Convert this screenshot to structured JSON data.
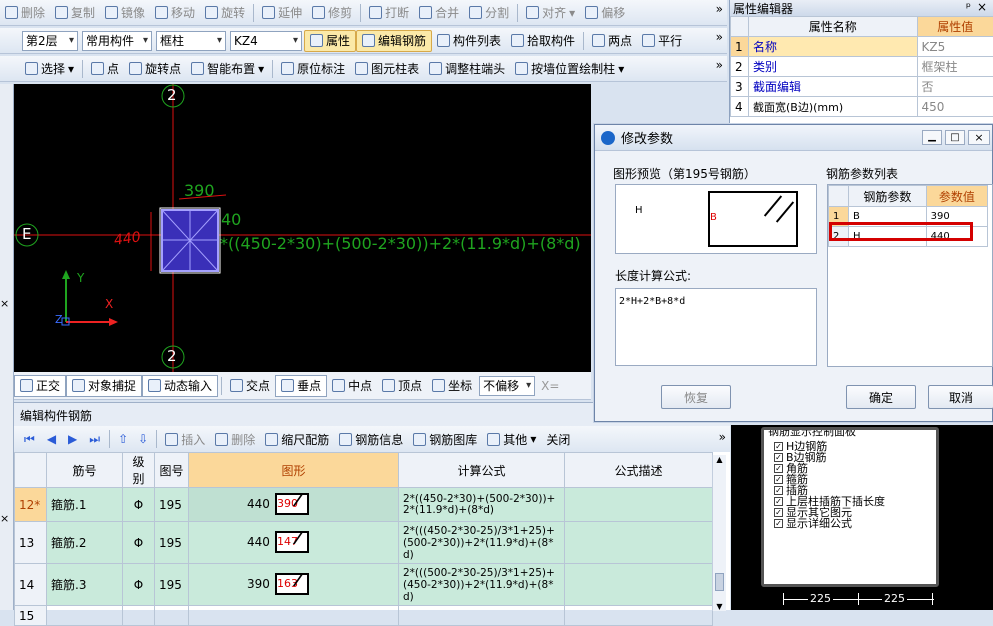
{
  "toolbar1": {
    "delete": "删除",
    "copy": "复制",
    "mirror": "镜像",
    "move": "移动",
    "rotate": "旋转",
    "extend": "延伸",
    "trim": "修剪",
    "break": "打断",
    "merge": "合并",
    "split": "分割",
    "align": "对齐",
    "offset": "偏移",
    "more": "»"
  },
  "toolbar2": {
    "floor": "第2层",
    "component_type": "常用构件",
    "element": "框柱",
    "name": "KZ4",
    "properties": "属性",
    "edit_rebar": "编辑钢筋",
    "component_list": "构件列表",
    "pick_component": "拾取构件",
    "two_points": "两点",
    "parallel": "平行",
    "more": "»"
  },
  "toolbar3": {
    "select": "选择",
    "point": "点",
    "rotate_point": "旋转点",
    "smart_layout": "智能布置",
    "in_situ_label": "原位标注",
    "element_table": "图元柱表",
    "adjust_column_end": "调整柱端头",
    "draw_by_wall": "按墙位置绘制柱",
    "more": "»"
  },
  "property_panel": {
    "title": "属性编辑器",
    "pin": "ᵖ",
    "close": "×",
    "col_name": "属性名称",
    "col_value": "属性值",
    "rows": [
      {
        "no": "1",
        "name": "名称",
        "value": "KZ5"
      },
      {
        "no": "2",
        "name": "类别",
        "value": "框架柱"
      },
      {
        "no": "3",
        "name": "截面编辑",
        "value": "否"
      },
      {
        "no": "4",
        "name": "截面宽(B边)(mm)",
        "value": "450"
      }
    ]
  },
  "canvas": {
    "axis_top": "2",
    "axis_bottom": "2",
    "axis_left": "E",
    "dim_top": "390",
    "dim_side": "40",
    "dim_left": "440",
    "formula": "*((450-2*30)+(500-2*30))+2*(11.9*d)+(8*d)",
    "ucs_y": "Y",
    "ucs_x": "X",
    "ucs_z": "Z"
  },
  "snap_bar": {
    "ortho": "正交",
    "object_snap": "对象捕捉",
    "dynamic_input": "动态输入",
    "intersection": "交点",
    "perpendicular": "垂点",
    "midpoint": "中点",
    "vertex": "顶点",
    "coordinate": "坐标",
    "no_offset": "不偏移",
    "x_label": "X="
  },
  "rebar_editor": {
    "title": "编辑构件钢筋",
    "toolbar": {
      "insert": "插入",
      "delete": "删除",
      "scale_rebar": "缩尺配筋",
      "rebar_info": "钢筋信息",
      "rebar_library": "钢筋图库",
      "other": "其他",
      "close": "关闭",
      "more": "»"
    },
    "headers": {
      "bar_no": "筋号",
      "grade": "级别",
      "shape_no": "图号",
      "shape": "图形",
      "formula": "计算公式",
      "description": "公式描述"
    },
    "rows": [
      {
        "idx": "12*",
        "bar_no": "箍筋.1",
        "grade": "Φ",
        "shape_no": "195",
        "left_val": "440",
        "inner_val": "390",
        "formula": "2*((450-2*30)+(500-2*30))+\n2*(11.9*d)+(8*d)",
        "description": ""
      },
      {
        "idx": "13",
        "bar_no": "箍筋.2",
        "grade": "Φ",
        "shape_no": "195",
        "left_val": "440",
        "inner_val": "147",
        "formula": "2*(((450-2*30-25)/3*1+25)+\n(500-2*30))+2*(11.9*d)+(8*\nd)",
        "description": ""
      },
      {
        "idx": "14",
        "bar_no": "箍筋.3",
        "grade": "Φ",
        "shape_no": "195",
        "left_val": "390",
        "inner_val": "163",
        "formula": "2*(((500-2*30-25)/3*1+25)+\n(450-2*30))+2*(11.9*d)+(8*\nd)",
        "description": ""
      },
      {
        "idx": "15",
        "bar_no": "",
        "grade": "",
        "shape_no": "",
        "left_val": "",
        "inner_val": "",
        "formula": "",
        "description": ""
      }
    ]
  },
  "dialog": {
    "title": "修改参数",
    "preview_label": "图形预览（第195号钢筋）",
    "preview_h": "H",
    "preview_b": "B",
    "param_list_label": "钢筋参数列表",
    "col_param": "钢筋参数",
    "col_value": "参数值",
    "params": [
      {
        "no": "1",
        "name": "B",
        "value": "390"
      },
      {
        "no": "2",
        "name": "H",
        "value": "440"
      }
    ],
    "length_label": "长度计算公式:",
    "length_formula": "2*H+2*B+8*d",
    "restore": "恢复",
    "ok": "确定",
    "cancel": "取消"
  },
  "display_panel": {
    "title": "钢筋显示控制面板",
    "options": [
      {
        "label": "H边钢筋",
        "checked": true
      },
      {
        "label": "B边钢筋",
        "checked": true
      },
      {
        "label": "角筋",
        "checked": true
      },
      {
        "label": "箍筋",
        "checked": true
      },
      {
        "label": "插筋",
        "checked": true
      },
      {
        "label": "上层柱插筋下插长度",
        "checked": true
      },
      {
        "label": "显示其它图元",
        "checked": true
      },
      {
        "label": "显示详细公式",
        "checked": true
      }
    ],
    "dim_a": "225",
    "dim_b": "225"
  },
  "colors": {
    "accent_red": "#d40000",
    "canvas_bg": "#000000",
    "rebar_green": "#1fa41f",
    "column_fill": "#3a2fb8",
    "selected_row": "#c9eadb"
  }
}
